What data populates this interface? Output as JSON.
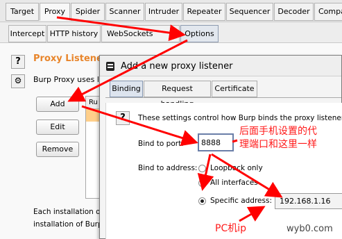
{
  "main_tabs": [
    "Target",
    "Proxy",
    "Spider",
    "Scanner",
    "Intruder",
    "Repeater",
    "Sequencer",
    "Decoder",
    "Compa"
  ],
  "sub_tabs": [
    "Intercept",
    "HTTP history",
    "WebSockets history",
    "Options"
  ],
  "listeners": {
    "title": "Proxy Listeners",
    "description": "Burp Proxy uses lis",
    "add_label": "Add",
    "edit_label": "Edit",
    "remove_label": "Remove",
    "table_header_first": "Ru",
    "footer_line1": "Each installation of B",
    "footer_line2": "installation of Burp."
  },
  "dialog": {
    "title": "Add a new proxy listener",
    "tabs": [
      "Binding",
      "Request handling",
      "Certificate"
    ],
    "description": "These settings control how Burp binds the proxy listener.",
    "bind_port_label": "Bind to port:",
    "bind_port_value": "8888",
    "bind_address_label": "Bind to address:",
    "options": [
      "Loopback only",
      "All interfaces",
      "Specific address:"
    ],
    "specific_address_value": "192.168.1.16"
  },
  "annotations": {
    "note_line1": "后面手机设置的代",
    "note_line2": "理端口和这里一样",
    "pc_ip": "PC机ip",
    "watermark": "wyb0.com"
  },
  "colors": {
    "annotation_red": "#ff0000",
    "title_orange": "#e8852b"
  }
}
